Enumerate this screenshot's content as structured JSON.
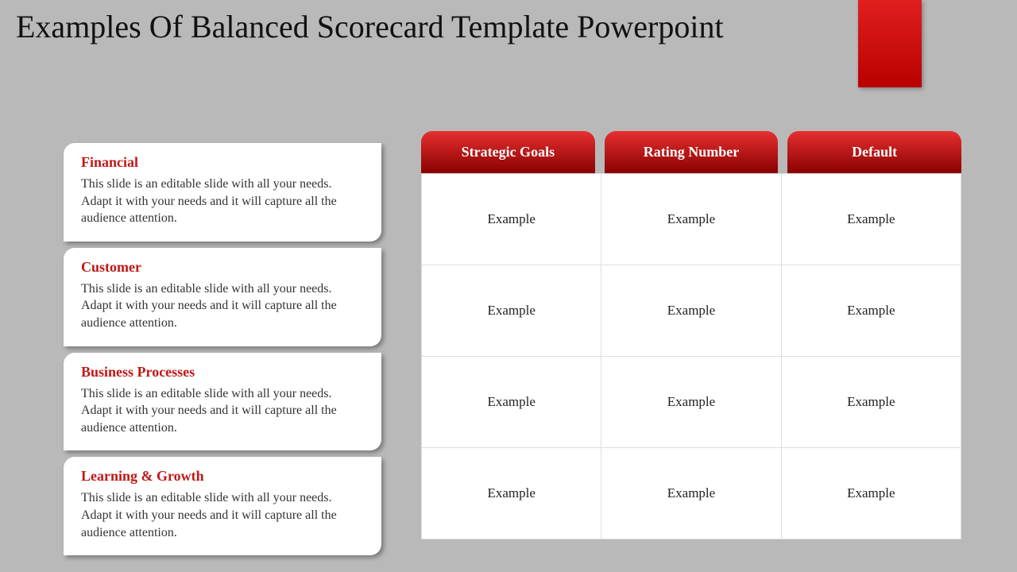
{
  "title": "Examples Of Balanced Scorecard Template Powerpoint",
  "accent_color": "#c01818",
  "cards": [
    {
      "title": "Financial",
      "body": "This slide is an editable slide with all your needs. Adapt it with your needs and it will capture all the audience attention."
    },
    {
      "title": "Customer",
      "body": "This slide is an editable slide with all your needs. Adapt it with your needs and it will capture all the audience attention."
    },
    {
      "title": "Business Processes",
      "body": "This slide is an editable slide with all your needs. Adapt it with your needs and it will capture all the audience attention."
    },
    {
      "title": "Learning & Growth",
      "body": "This slide is an editable slide with all your needs. Adapt it with your needs and it will capture all the audience attention."
    }
  ],
  "table": {
    "headers": [
      "Strategic Goals",
      "Rating Number",
      "Default"
    ],
    "rows": [
      [
        "Example",
        "Example",
        "Example"
      ],
      [
        "Example",
        "Example",
        "Example"
      ],
      [
        "Example",
        "Example",
        "Example"
      ],
      [
        "Example",
        "Example",
        "Example"
      ]
    ]
  }
}
